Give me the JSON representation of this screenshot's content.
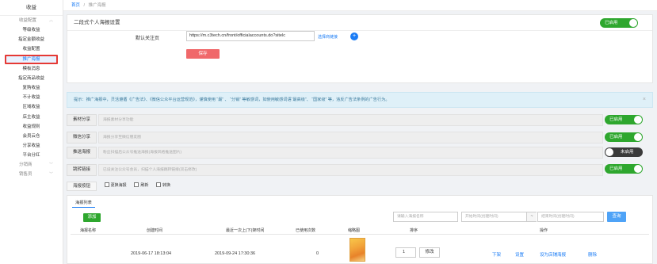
{
  "sidebar": {
    "title": "收益",
    "groups": [
      {
        "label": "收益配置",
        "items": [
          "等级收益",
          "指定金额收益",
          "收益配置",
          "推广海报",
          "模板消息"
        ]
      },
      {
        "label": "",
        "items": [
          "指定商品收益",
          "复购收益",
          "不计收益",
          "区域收益",
          "店主收益",
          "收益规则",
          "会员云仓",
          "分享收益",
          "平台分红"
        ]
      }
    ],
    "collapsed": [
      {
        "label": "分销商"
      },
      {
        "label": "销售员"
      }
    ],
    "active_item": "推广海报"
  },
  "breadcrumb": {
    "home": "首页",
    "sep": "/",
    "current": "推广海报"
  },
  "poster_settings": {
    "title": "二段式个人海报设置",
    "status": "已启用",
    "follow_label": "默认关注页",
    "follow_url": "https://m.c3tech.cn/front/officialaccounts.do?sitelc",
    "choose_link": "选择商链接",
    "plus": "+",
    "save": "保存"
  },
  "notice": {
    "text": "提示：推广海报中，灵活遵循《广告法》、《微信公众平台运营规范》，谨慎使用 “最” 、 “分销” 等敏感词，如使用敏感词语“最高级”、 “国家级” 等，违反广告法条例的广告行为。",
    "close": "×"
  },
  "share_rows": [
    {
      "name": "素材分享",
      "placeholder": "海报素材分享功能",
      "status": "已启用",
      "on": true
    },
    {
      "name": "微信分享",
      "placeholder": "海报分享至微信朋友圈",
      "status": "已启用",
      "on": true
    },
    {
      "name": "推送海报",
      "placeholder": "粉丝扫描后公众号推送海报(海报风格推送图片)",
      "status": "未启用",
      "on": false
    },
    {
      "name": "跳转链接",
      "placeholder": "已设关注公众号会员，扫描个人海报跳转链接(双击修改)",
      "status": "已启用",
      "on": true
    }
  ],
  "poster_buttons": {
    "label": "海报按钮",
    "options": [
      "更换海报",
      "刷新",
      "转换"
    ]
  },
  "list": {
    "tab": "海报列表",
    "add": "添加",
    "filter_name_placeholder": "请输入海报名称",
    "filter_start_placeholder": "开始时间(创建时间)",
    "filter_sep": "~",
    "filter_end_placeholder": "结束时间(创建时间)",
    "search": "查询",
    "columns": [
      "海报名称",
      "创建时间",
      "最近一次上(下)架时间",
      "已使用次数",
      "缩略图",
      "排序",
      "操作"
    ],
    "rows": [
      {
        "name": "",
        "created": "2019-06-17 18:13:04",
        "last_shelf": "2019-09-24 17:30:36",
        "used": "0",
        "sort": "1",
        "edit": "修改",
        "actions": [
          "下架",
          "设置",
          "设为店铺海报",
          "删除"
        ]
      }
    ]
  },
  "colors": {
    "accent": "#1a7cf5",
    "toggle_on": "#2ea72e",
    "toggle_off": "#3a3a3a",
    "save": "#f0686a",
    "active_outline": "#e53935"
  }
}
